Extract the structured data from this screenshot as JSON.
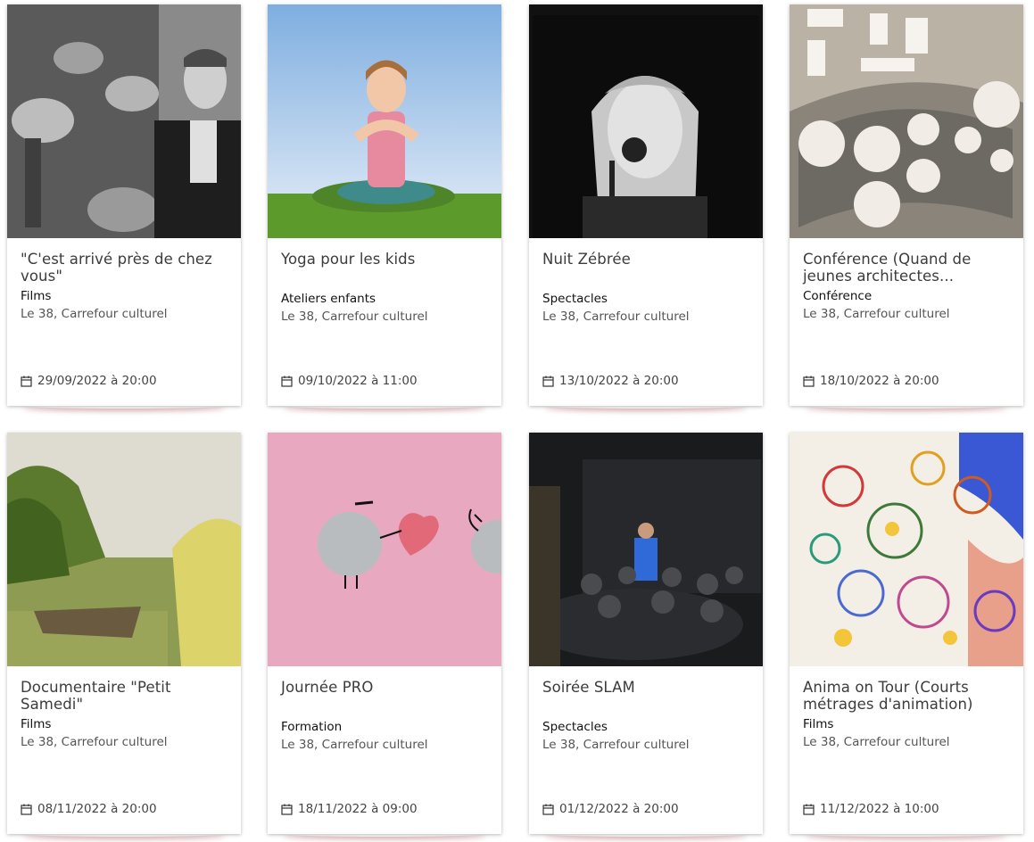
{
  "events": [
    {
      "title": "\"C'est arrivé près de chez vous\"",
      "category": "Films",
      "venue": "Le 38, Carrefour culturel",
      "date": "29/09/2022 à 20:00"
    },
    {
      "title": "Yoga pour les kids",
      "category": "Ateliers enfants",
      "venue": "Le 38, Carrefour culturel",
      "date": "09/10/2022 à 11:00"
    },
    {
      "title": "Nuit Zébrée",
      "category": "Spectacles",
      "venue": "Le 38, Carrefour culturel",
      "date": "13/10/2022 à 20:00"
    },
    {
      "title": "Conférence (Quand de jeunes architectes...",
      "category": "Conférence",
      "venue": "Le 38, Carrefour culturel",
      "date": "18/10/2022 à 20:00"
    },
    {
      "title": "Documentaire \"Petit Samedi\"",
      "category": "Films",
      "venue": "Le 38, Carrefour culturel",
      "date": "08/11/2022 à 20:00"
    },
    {
      "title": "Journée PRO",
      "category": "Formation",
      "venue": "Le 38, Carrefour culturel",
      "date": "18/11/2022 à 09:00"
    },
    {
      "title": "Soirée SLAM",
      "category": "Spectacles",
      "venue": "Le 38, Carrefour culturel",
      "date": "01/12/2022 à 20:00"
    },
    {
      "title": "Anima on Tour (Courts métrages d'animation)",
      "category": "Films",
      "venue": "Le 38, Carrefour culturel",
      "date": "11/12/2022 à 10:00"
    }
  ],
  "icons": {
    "date": "calendar-icon"
  }
}
